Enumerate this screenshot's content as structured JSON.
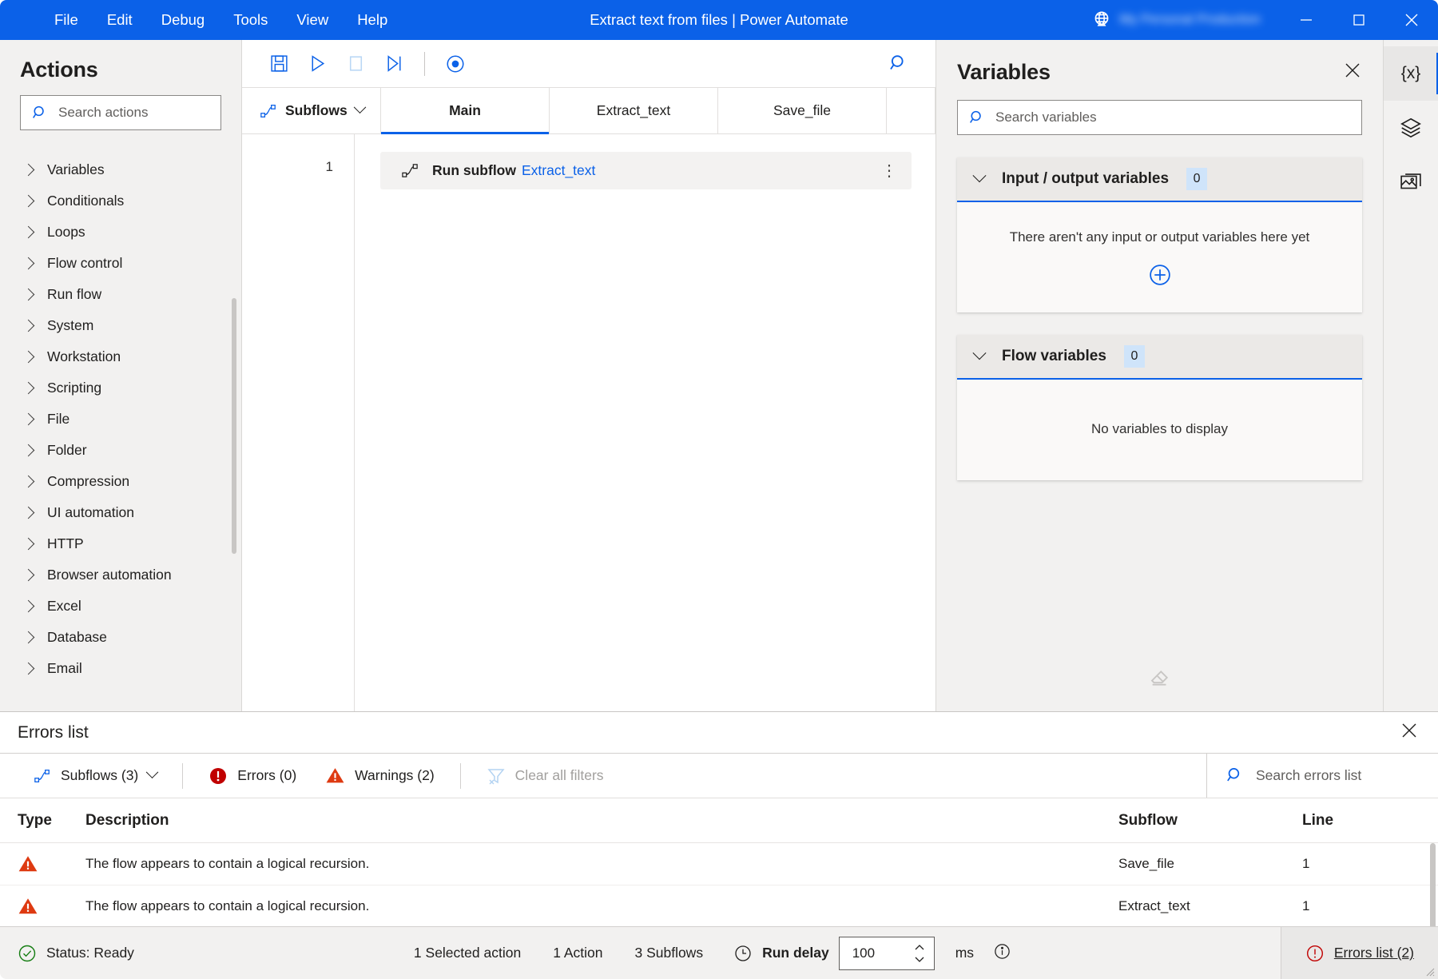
{
  "titlebar": {
    "menu": [
      "File",
      "Edit",
      "Debug",
      "Tools",
      "View",
      "Help"
    ],
    "window_title": "Extract text from files | Power Automate",
    "environment_name": "My Personal Production",
    "globe_icon": "globe-icon",
    "minimize_icon": "minimize-icon",
    "maximize_icon": "maximize-icon",
    "close_icon": "close-icon"
  },
  "actions_panel": {
    "title": "Actions",
    "search_placeholder": "Search actions",
    "search_icon": "search-icon",
    "groups": [
      "Variables",
      "Conditionals",
      "Loops",
      "Flow control",
      "Run flow",
      "System",
      "Workstation",
      "Scripting",
      "File",
      "Folder",
      "Compression",
      "UI automation",
      "HTTP",
      "Browser automation",
      "Excel",
      "Database",
      "Email"
    ]
  },
  "toolbar": {
    "buttons": [
      {
        "name": "save-icon",
        "title": "Save"
      },
      {
        "name": "run-icon",
        "title": "Run"
      },
      {
        "name": "stop-icon",
        "title": "Stop"
      },
      {
        "name": "run-next-action-icon",
        "title": "Run next action"
      },
      {
        "name": "recorder-icon",
        "title": "Recorder"
      }
    ],
    "search_icon": "search-icon"
  },
  "tabs": {
    "subflows_label": "Subflows",
    "subflows_icon": "subflow-icon",
    "chevron_icon": "chevron-down-icon",
    "items": [
      {
        "label": "Main",
        "active": true
      },
      {
        "label": "Extract_text",
        "active": false
      },
      {
        "label": "Save_file",
        "active": false
      }
    ]
  },
  "canvas": {
    "rows": [
      {
        "line": "1",
        "icon": "subflow-icon",
        "action": "Run subflow",
        "argument": "Extract_text",
        "more_icon": "more-options-icon"
      }
    ]
  },
  "variables_panel": {
    "title": "Variables",
    "close_icon": "close-icon",
    "search_placeholder": "Search variables",
    "search_icon": "search-icon",
    "sections": [
      {
        "title": "Input / output variables",
        "count": "0",
        "empty_message": "There aren't any input or output variables here yet",
        "add_icon": "add-circle-icon",
        "has_add": true
      },
      {
        "title": "Flow variables",
        "count": "0",
        "empty_message": "No variables to display",
        "has_add": false
      }
    ],
    "eraser_icon": "eraser-icon"
  },
  "rail": {
    "items": [
      {
        "name": "variables-icon",
        "glyph": "{x}",
        "selected": true
      },
      {
        "name": "ui-elements-icon",
        "glyph": "layers",
        "selected": false
      },
      {
        "name": "images-icon",
        "glyph": "images",
        "selected": false
      }
    ]
  },
  "errors_list": {
    "title": "Errors list",
    "close_icon": "close-icon",
    "filters": {
      "subflows_label": "Subflows (3)",
      "subflows_icon": "subflow-icon",
      "chevron_icon": "chevron-down-icon",
      "errors_label": "Errors (0)",
      "errors_icon": "error-circle-icon",
      "warnings_label": "Warnings (2)",
      "warnings_icon": "warning-triangle-icon",
      "clear_label": "Clear all filters",
      "clear_icon": "clear-filter-icon",
      "search_placeholder": "Search errors list",
      "search_icon": "search-icon"
    },
    "columns": [
      "Type",
      "Description",
      "Subflow",
      "Line"
    ],
    "rows": [
      {
        "type_icon": "warning-triangle-icon",
        "description": "The flow appears to contain a logical recursion.",
        "subflow": "Save_file",
        "line": "1"
      },
      {
        "type_icon": "warning-triangle-icon",
        "description": "The flow appears to contain a logical recursion.",
        "subflow": "Extract_text",
        "line": "1"
      }
    ]
  },
  "status_bar": {
    "status_icon": "check-circle-icon",
    "status_label": "Status: Ready",
    "selected_actions": "1 Selected action",
    "actions_count": "1 Action",
    "subflows_count": "3 Subflows",
    "clock_icon": "clock-icon",
    "run_delay_label": "Run delay",
    "run_delay_value": "100",
    "ms_label": "ms",
    "info_icon": "info-icon",
    "errors_link_icon": "error-circle-icon",
    "errors_link_label": "Errors list (2)"
  },
  "colors": {
    "accent": "#0b61e8",
    "warning": "#d83b01",
    "error": "#b30000",
    "success": "#107c10",
    "panel_bg": "#f2f1f0"
  }
}
